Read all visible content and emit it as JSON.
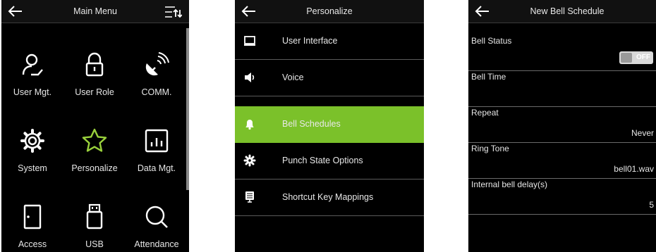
{
  "main_menu": {
    "title": "Main Menu",
    "items": [
      {
        "label": "User Mgt."
      },
      {
        "label": "User Role"
      },
      {
        "label": "COMM."
      },
      {
        "label": "System"
      },
      {
        "label": "Personalize"
      },
      {
        "label": "Data Mgt."
      },
      {
        "label": "Access"
      },
      {
        "label": "USB"
      },
      {
        "label": "Attendance"
      }
    ]
  },
  "personalize": {
    "title": "Personalize",
    "items": [
      {
        "label": "User Interface",
        "icon": "monitor-icon"
      },
      {
        "label": "Voice",
        "icon": "speaker-icon"
      },
      {
        "label": "Bell Schedules",
        "icon": "bell-icon",
        "selected": true
      },
      {
        "label": "Punch State Options",
        "icon": "gear-icon"
      },
      {
        "label": "Shortcut Key Mappings",
        "icon": "keyboard-icon"
      }
    ]
  },
  "bell_schedule": {
    "title": "New Bell Schedule",
    "fields": [
      {
        "label": "Bell Status",
        "toggle": "OFF"
      },
      {
        "label": "Bell Time",
        "value": ""
      },
      {
        "label": "Repeat",
        "value": "Never"
      },
      {
        "label": "Ring Tone",
        "value": "bell01.wav"
      },
      {
        "label": "Internal bell delay(s)",
        "value": "5"
      }
    ]
  },
  "colors": {
    "accent": "#7bc12a",
    "selected_star": "#9ad13c",
    "background": "#000000"
  }
}
